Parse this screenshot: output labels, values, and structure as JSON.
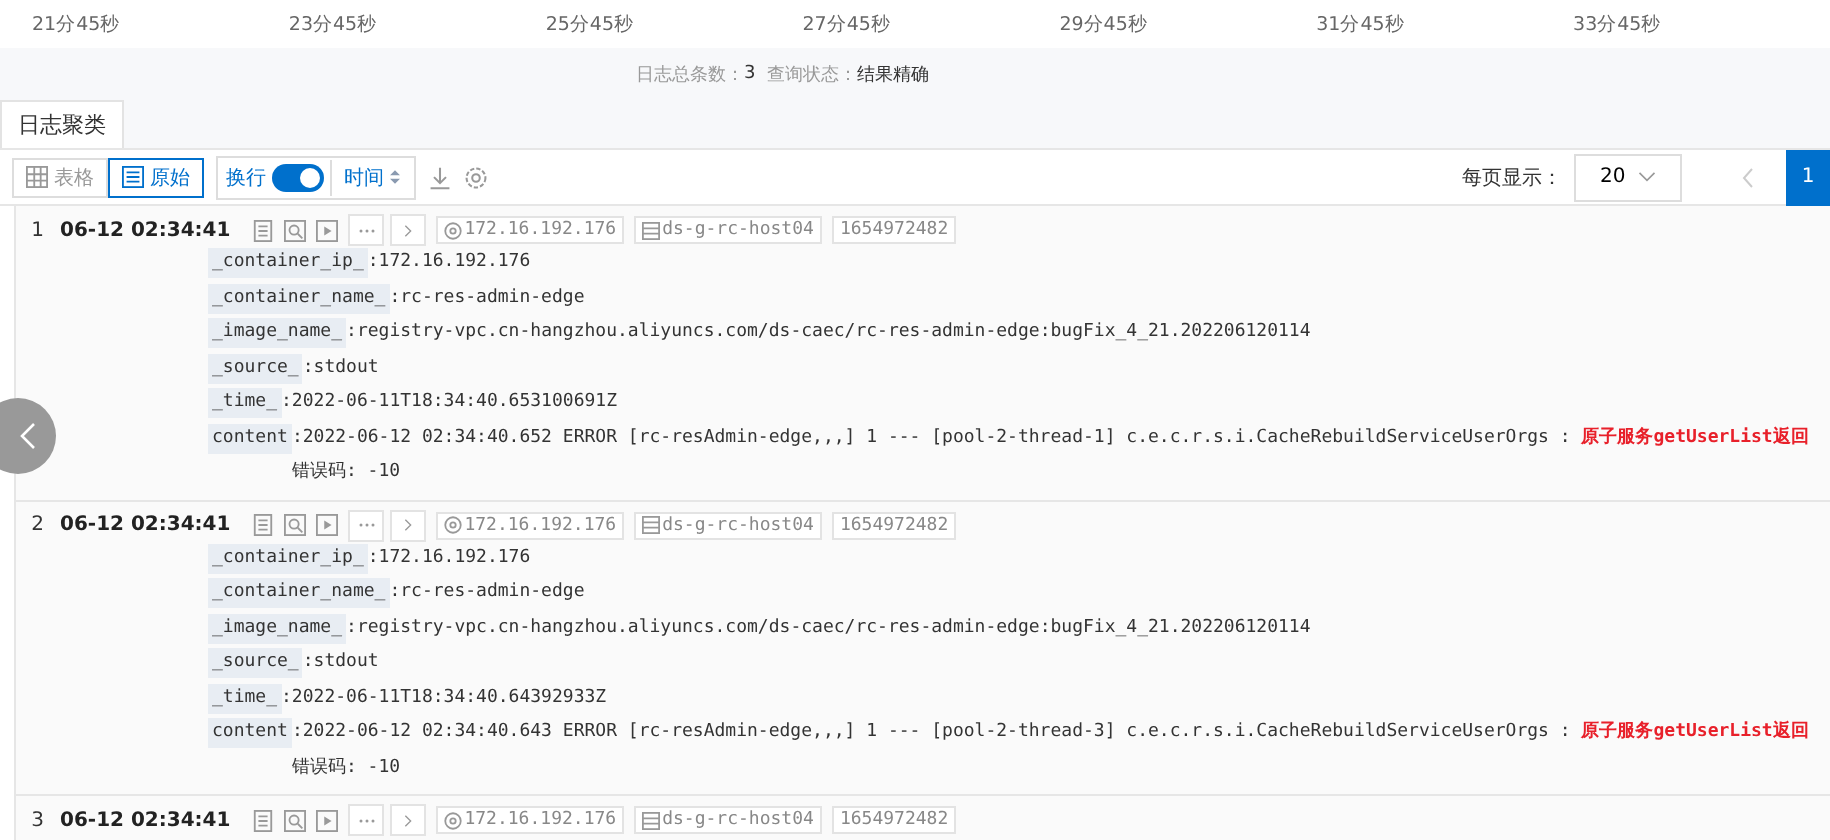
{
  "timeline": {
    "ticks": [
      "21分45秒",
      "23分45秒",
      "25分45秒",
      "27分45秒",
      "29分45秒",
      "31分45秒",
      "33分45秒"
    ]
  },
  "summary": {
    "count_label": "日志总条数：",
    "count": "3",
    "status_label": "查询状态：",
    "status": "结果精确"
  },
  "tabs": [
    {
      "label": "日志聚类",
      "selected": true
    }
  ],
  "toolbar": {
    "views": [
      {
        "kind": "table",
        "label": "表格",
        "selected": false
      },
      {
        "kind": "list",
        "label": "原始",
        "selected": true
      }
    ],
    "wrap": {
      "label": "换行",
      "on": true
    },
    "sort": {
      "label": "时间"
    }
  },
  "pagination": {
    "label": "每页显示：",
    "page_size": "20",
    "pages": [
      {
        "label": "1",
        "selected": true
      }
    ]
  },
  "logs": [
    {
      "index": "1",
      "time": "06-12 02:34:41",
      "tags": [
        {
          "kind": "ip",
          "text": "172.16.192.176"
        },
        {
          "kind": "host",
          "text": "ds-g-rc-host04"
        },
        {
          "kind": "plain",
          "text": "1654972482"
        }
      ],
      "fields": [
        {
          "key": "_container_ip_",
          "value": ":172.16.192.176"
        },
        {
          "key": "_container_name_",
          "value": ":rc-res-admin-edge"
        },
        {
          "key": "_image_name_",
          "value": ":registry-vpc.cn-hangzhou.aliyuncs.com/ds-caec/rc-res-admin-edge:bugFix_4_21.202206120114"
        },
        {
          "key": "_source_",
          "value": ":stdout"
        },
        {
          "key": "_time_",
          "value": ":2022-06-11T18:34:40.653100691Z"
        },
        {
          "key": "content",
          "value": ":2022-06-12 02:34:40.652 ERROR [rc-resAdmin-edge,,,] 1 --- [pool-2-thread-1] c.e.c.r.s.i.CacheRebuildServiceUserOrgs  : ",
          "highlight": "原子服务getUserList返回",
          "tail": "错误码: -10"
        }
      ]
    },
    {
      "index": "2",
      "time": "06-12 02:34:41",
      "tags": [
        {
          "kind": "ip",
          "text": "172.16.192.176"
        },
        {
          "kind": "host",
          "text": "ds-g-rc-host04"
        },
        {
          "kind": "plain",
          "text": "1654972482"
        }
      ],
      "fields": [
        {
          "key": "_container_ip_",
          "value": ":172.16.192.176"
        },
        {
          "key": "_container_name_",
          "value": ":rc-res-admin-edge"
        },
        {
          "key": "_image_name_",
          "value": ":registry-vpc.cn-hangzhou.aliyuncs.com/ds-caec/rc-res-admin-edge:bugFix_4_21.202206120114"
        },
        {
          "key": "_source_",
          "value": ":stdout"
        },
        {
          "key": "_time_",
          "value": ":2022-06-11T18:34:40.64392933Z"
        },
        {
          "key": "content",
          "value": ":2022-06-12 02:34:40.643 ERROR [rc-resAdmin-edge,,,] 1 --- [pool-2-thread-3] c.e.c.r.s.i.CacheRebuildServiceUserOrgs  : ",
          "highlight": "原子服务getUserList返回",
          "tail": "错误码: -10"
        }
      ]
    },
    {
      "index": "3",
      "time": "06-12 02:34:41",
      "tags": [
        {
          "kind": "ip",
          "text": "172.16.192.176"
        },
        {
          "kind": "host",
          "text": "ds-g-rc-host04"
        },
        {
          "kind": "plain",
          "text": "1654972482"
        }
      ]
    }
  ]
}
